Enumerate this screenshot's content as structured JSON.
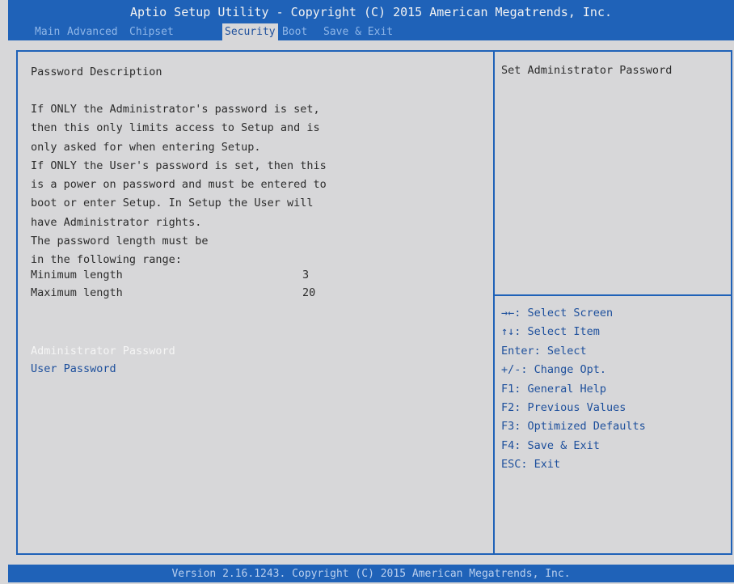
{
  "header": {
    "title": "Aptio Setup Utility - Copyright (C) 2015 American Megatrends, Inc.",
    "tabs": [
      {
        "label": "Main"
      },
      {
        "label": "Advanced"
      },
      {
        "label": "Chipset"
      },
      {
        "label": "Security",
        "active": true
      },
      {
        "label": "Boot"
      },
      {
        "label": "Save & Exit"
      }
    ]
  },
  "main": {
    "description_title": "Password Description",
    "description_lines": [
      "If ONLY the Administrator's password is set,",
      "then this only limits access to Setup and is",
      "only asked for when entering Setup.",
      "If ONLY the User's password is set, then this",
      "is a power on password and must be entered to",
      "boot or enter Setup. In Setup the User will",
      "have Administrator rights.",
      "The password length must be",
      "in the following range:"
    ],
    "minimum_length": {
      "label": "Minimum length",
      "value": "3"
    },
    "maximum_length": {
      "label": "Maximum length",
      "value": "20"
    },
    "items": [
      {
        "label": "Administrator Password",
        "selected": true
      },
      {
        "label": "User Password"
      }
    ]
  },
  "help": {
    "text": "Set Administrator Password",
    "keys": [
      "→←: Select Screen",
      "↑↓: Select Item",
      "Enter: Select",
      "+/-: Change Opt.",
      "F1: General Help",
      "F2: Previous Values",
      "F3: Optimized Defaults",
      "F4: Save & Exit",
      "ESC: Exit"
    ]
  },
  "footer": {
    "text": "Version 2.16.1243. Copyright (C) 2015 American Megatrends, Inc."
  },
  "colors": {
    "accent_blue": "#1f62b8",
    "background": "#d7d7d9",
    "selected_text": "#f5f5f5",
    "link_text": "#1d4f9c"
  }
}
